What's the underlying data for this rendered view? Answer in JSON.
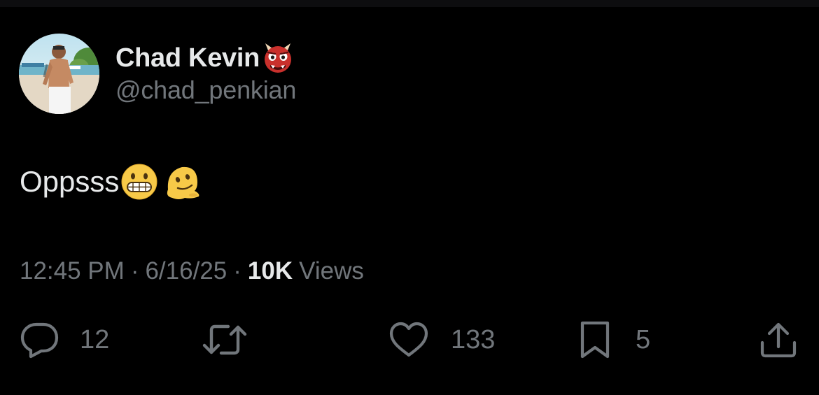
{
  "post": {
    "author": {
      "display_name": "Chad Kevin",
      "name_emoji": "ogre-emoji",
      "handle": "@chad_penkian",
      "avatar": "profile-photo"
    },
    "text": "Oppsss",
    "text_emojis": [
      "grimacing-face-emoji",
      "melting-face-emoji"
    ],
    "meta": {
      "time": "12:45 PM",
      "separator": "·",
      "date": "6/16/25",
      "views_count": "10K",
      "views_label": "Views"
    },
    "actions": {
      "replies": {
        "icon": "reply-icon",
        "count": "12"
      },
      "retweets": {
        "icon": "retweet-icon",
        "count": ""
      },
      "likes": {
        "icon": "heart-icon",
        "count": "133"
      },
      "bookmarks": {
        "icon": "bookmark-icon",
        "count": "5"
      },
      "share": {
        "icon": "share-icon"
      }
    }
  },
  "colors": {
    "background": "#000000",
    "primary_text": "#e7e9ea",
    "secondary_text": "#71767b"
  }
}
